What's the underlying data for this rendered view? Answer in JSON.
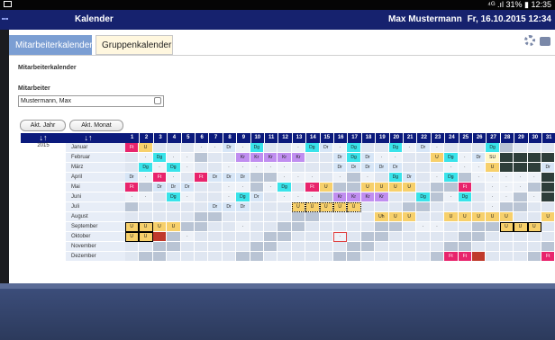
{
  "status_bar": {
    "indicators": "⁴ᴳ .ıl 31% ▮ 12:35"
  },
  "header": {
    "app_title": "Kalender",
    "user": "Max Mustermann",
    "date": "Fr, 16.10.2015 12:34"
  },
  "tabs": [
    {
      "label": "Mitarbeiterkalender",
      "active": true
    },
    {
      "label": "Gruppenkalender",
      "active": false
    }
  ],
  "page": {
    "section_title": "Mitarbeiterkalender",
    "employee_label": "Mitarbeiter",
    "employee_value": "Mustermann, Max",
    "buttons": {
      "year": "Akt. Jahr",
      "month": "Akt. Monat"
    }
  },
  "calendar": {
    "year_label": "2015",
    "arrows": [
      "↓↑",
      "↓↑"
    ],
    "days": [
      "1",
      "2",
      "3",
      "4",
      "5",
      "6",
      "7",
      "8",
      "9",
      "10",
      "11",
      "12",
      "13",
      "14",
      "15",
      "16",
      "17",
      "18",
      "19",
      "20",
      "21",
      "22",
      "23",
      "24",
      "25",
      "26",
      "27",
      "28",
      "29",
      "30",
      "31"
    ],
    "months": [
      {
        "name": "Januar",
        "cells": [
          "Ft",
          "U",
          "",
          "",
          "",
          "·",
          "·",
          "Dr",
          "·",
          "Dg",
          "",
          "",
          "·",
          "Dg",
          "Dr",
          "·",
          "Dg",
          "",
          "",
          "Dg",
          "·",
          "Dr",
          "·",
          "",
          "",
          "",
          "Dg",
          "",
          "",
          "",
          ""
        ]
      },
      {
        "name": "Februar",
        "cells": [
          "",
          "·",
          "Dg",
          "·",
          "·",
          "",
          "",
          "",
          "Kr",
          "Kr",
          "Kr",
          "Kr",
          "Kr",
          "",
          "",
          "Dr",
          "Dg",
          "Dr",
          "·",
          "·",
          "",
          "",
          "U",
          "Dg",
          "·",
          "Dr",
          "SU",
          "",
          "",
          "",
          ""
        ]
      },
      {
        "name": "März",
        "cells": [
          "",
          "Dg",
          "·",
          "Dg",
          "·",
          "",
          "",
          "·",
          "·",
          "·",
          "·",
          "·",
          "",
          "",
          "",
          "Dr",
          "Dr",
          "Dr",
          "Dr",
          "Dr",
          "",
          "",
          "",
          "·",
          "·",
          "·",
          "U",
          "",
          "",
          "",
          "Dr"
        ]
      },
      {
        "name": "April",
        "cells": [
          "Dr",
          "·",
          "Ft",
          "·",
          "",
          "Ft",
          "Dr",
          "Dr",
          "Dr",
          "",
          "",
          "·",
          "·",
          "·",
          "",
          "·",
          "",
          "·",
          "",
          "Dg",
          "Dr",
          "",
          "·",
          "Dg",
          "",
          "·",
          "·",
          "·",
          "·",
          "·",
          ""
        ]
      },
      {
        "name": "Mai",
        "cells": [
          "Ft",
          "",
          "Dr",
          "Dr",
          "Dr",
          "",
          "",
          "·",
          "·",
          "",
          "·",
          "Dg",
          "",
          "Ft",
          "U",
          "",
          "",
          "U",
          "U",
          "U",
          "U",
          "",
          "",
          "",
          "Ft",
          "",
          "·",
          "·",
          "·",
          "",
          ""
        ]
      },
      {
        "name": "Juni",
        "cells": [
          "·",
          "·",
          "",
          "Dg",
          "·",
          "",
          "",
          "·",
          "Dg",
          "Dr",
          "",
          "·",
          "·",
          "·",
          "",
          "Kr",
          "Kr",
          "Kr",
          "Kr",
          "",
          "",
          "Dg",
          "",
          "·",
          "Dg",
          "",
          "·",
          "·",
          "",
          "·",
          ""
        ]
      },
      {
        "name": "Juli",
        "cells": [
          "",
          "",
          "",
          "",
          "",
          "",
          "Dr",
          "Dr",
          "Dr",
          "",
          "",
          "",
          "U",
          "U",
          "U",
          "U",
          "U",
          "",
          "",
          "",
          "",
          "",
          "",
          "",
          "",
          "",
          "·",
          "",
          "",
          "",
          ""
        ]
      },
      {
        "name": "August",
        "cells": [
          "",
          "",
          "",
          "",
          "",
          "",
          "",
          "",
          "",
          "",
          "",
          "",
          "",
          "",
          "",
          "",
          "",
          "",
          "Uh",
          "U",
          "U",
          "",
          "",
          "U",
          "U",
          "U",
          "U",
          "U",
          "",
          "",
          "U"
        ]
      },
      {
        "name": "September",
        "cells": [
          "U",
          "U",
          "U",
          "U",
          "",
          "",
          "",
          "",
          "·",
          "",
          "",
          "",
          "",
          "",
          "",
          "",
          "",
          "",
          "",
          "",
          "",
          "·",
          "·",
          "",
          "",
          "",
          "",
          "U",
          "U",
          "U",
          ""
        ]
      },
      {
        "name": "Oktober",
        "cells": [
          "U",
          "U",
          "",
          "",
          "·",
          "",
          "",
          "",
          "",
          "",
          "",
          "",
          "",
          "",
          "",
          "·",
          "",
          "",
          "",
          "",
          "",
          "",
          "",
          "",
          "",
          "",
          "",
          "",
          "",
          "",
          ""
        ]
      },
      {
        "name": "November",
        "cells": [
          "",
          "",
          "",
          "",
          "",
          "",
          "",
          "",
          "",
          "",
          "",
          "",
          "",
          "",
          "",
          "",
          "",
          "",
          "",
          "",
          "",
          "",
          "",
          "",
          "",
          "",
          "",
          "",
          "",
          "",
          ""
        ]
      },
      {
        "name": "Dezember",
        "cells": [
          "",
          "",
          "",
          "",
          "",
          "",
          "",
          "",
          "",
          "",
          "",
          "",
          "",
          "",
          "",
          "",
          "",
          "",
          "",
          "",
          "",
          "",
          "",
          "Ft",
          "Ft",
          "",
          "",
          "",
          "",
          "",
          "Ft"
        ]
      }
    ]
  },
  "colors": {
    "header_bg": "#16226e",
    "table_head_bg": "#0b1a7c",
    "tab_active": "#7b9ed3",
    "vacation_U": "#f7d06b",
    "holiday_Ft": "#e8246c",
    "Dg": "#39e3ea",
    "Kr": "#c08ef0",
    "Dr": "#d7e6f7",
    "weekend_dark": "#2e3e3a"
  }
}
